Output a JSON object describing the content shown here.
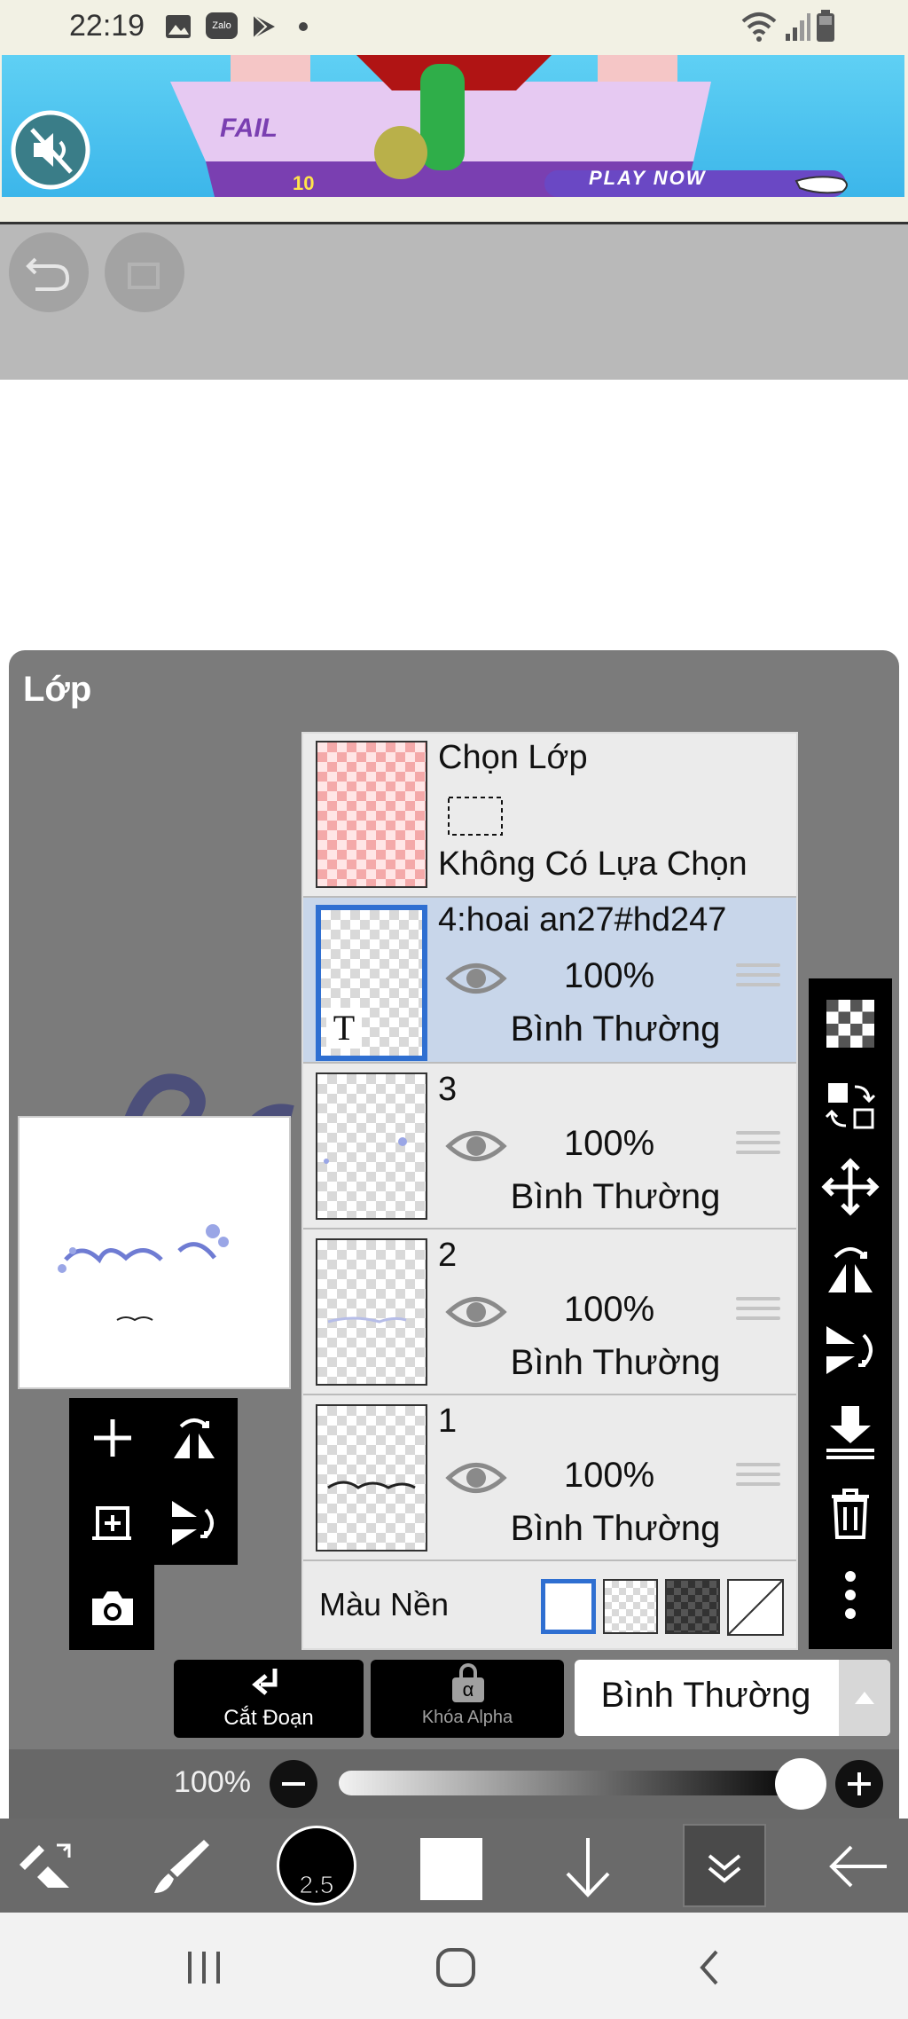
{
  "status_bar": {
    "time": "22:19",
    "icons": [
      "gallery-icon",
      "zalo-icon",
      "play-store-icon",
      "dot-icon",
      "wifi-icon",
      "signal-icon",
      "battery-icon"
    ],
    "zalo_label": "Zalo"
  },
  "ad": {
    "fail_text": "FAIL",
    "score_text": "10",
    "cta": "PLAY NOW"
  },
  "panel": {
    "title": "Lớp"
  },
  "layers": {
    "selection_row": {
      "title": "Chọn Lớp",
      "subtitle": "Không Có Lựa Chọn"
    },
    "items": [
      {
        "name": "4:hoai an27#hd247",
        "opacity": "100%",
        "blend": "Bình Thường",
        "type_badge": "T",
        "selected": true
      },
      {
        "name": "3",
        "opacity": "100%",
        "blend": "Bình Thường",
        "selected": false
      },
      {
        "name": "2",
        "opacity": "100%",
        "blend": "Bình Thường",
        "selected": false
      },
      {
        "name": "1",
        "opacity": "100%",
        "blend": "Bình Thường",
        "selected": false
      }
    ],
    "background_label": "Màu Nền"
  },
  "controls": {
    "clipping_label": "Cắt Đoạn",
    "alpha_lock_label": "Khóa Alpha",
    "alpha_symbol": "α",
    "blend_mode_value": "Bình Thường",
    "opacity_label": "100%"
  },
  "bottom_toolbar": {
    "brush_size": "2.5"
  },
  "colors": {
    "selected_border": "#2f6fd1",
    "selected_row": "#c8d6ea",
    "panel_bg": "#7b7b7b"
  }
}
